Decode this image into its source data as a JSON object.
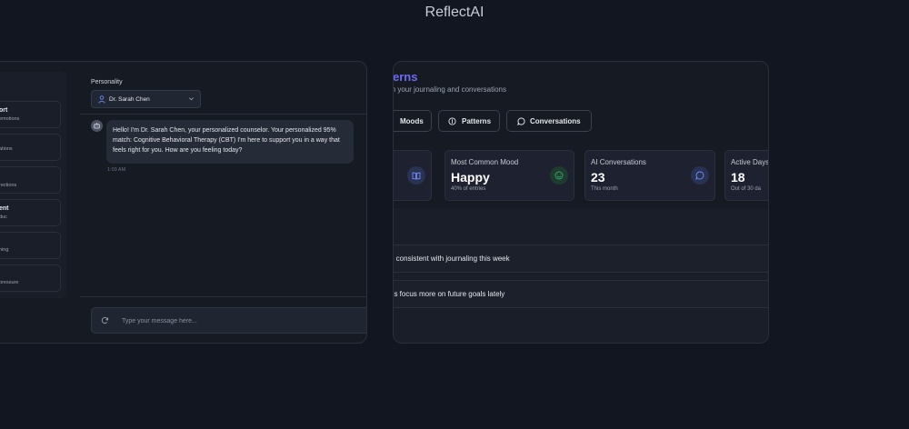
{
  "app": {
    "title": "ReflectAI"
  },
  "chat": {
    "sidebar": {
      "items": [
        {
          "title": "ort",
          "subtitle": "emotions"
        },
        {
          "title": "",
          "subtitle": "ations"
        },
        {
          "title": "",
          "subtitle": "rections"
        },
        {
          "title": "ent",
          "subtitle": "duc"
        },
        {
          "title": "",
          "subtitle": "hing"
        },
        {
          "title": "",
          "subtitle": "pressure"
        }
      ]
    },
    "personality": {
      "label": "Personality",
      "selected": "Dr. Sarah Chen"
    },
    "messages": [
      {
        "sender": "bot",
        "text": "Hello! I'm Dr. Sarah Chen, your personalized counselor. Your personalized 95% match: Cognitive Behavioral Therapy (CBT) I'm here to support you in a way that feels right for you. How are you feeling today?",
        "time": "1:03 AM"
      }
    ],
    "input": {
      "placeholder": "Type your message here..."
    }
  },
  "patterns": {
    "title": "erns",
    "subtitle": "om your journaling and conversations",
    "tabs": [
      {
        "label": "Moods",
        "icon": "none"
      },
      {
        "label": "Patterns",
        "icon": "info-icon"
      },
      {
        "label": "Conversations",
        "icon": "message-circle-icon"
      }
    ],
    "stats": [
      {
        "label": "",
        "value": "",
        "sub": "",
        "icon": "book-icon",
        "icon_color": "#4f6fdc"
      },
      {
        "label": "Most Common Mood",
        "value": "Happy",
        "sub": "40% of entries",
        "icon": "smile-icon",
        "icon_color": "#2fae6b"
      },
      {
        "label": "AI Conversations",
        "value": "23",
        "sub": "This month",
        "icon": "message-circle-icon",
        "icon_color": "#4f6fdc"
      },
      {
        "label": "Active Days",
        "value": "18",
        "sub": "Out of 30 da",
        "icon": "none"
      }
    ],
    "insights": [
      {
        "text": "e consistent with journaling this week"
      },
      {
        "text": "ns focus more on future goals lately"
      }
    ]
  },
  "colors": {
    "background": "#121620",
    "card": "#161a23",
    "accent": "#6d6af5",
    "border": "#2a2f3b"
  }
}
